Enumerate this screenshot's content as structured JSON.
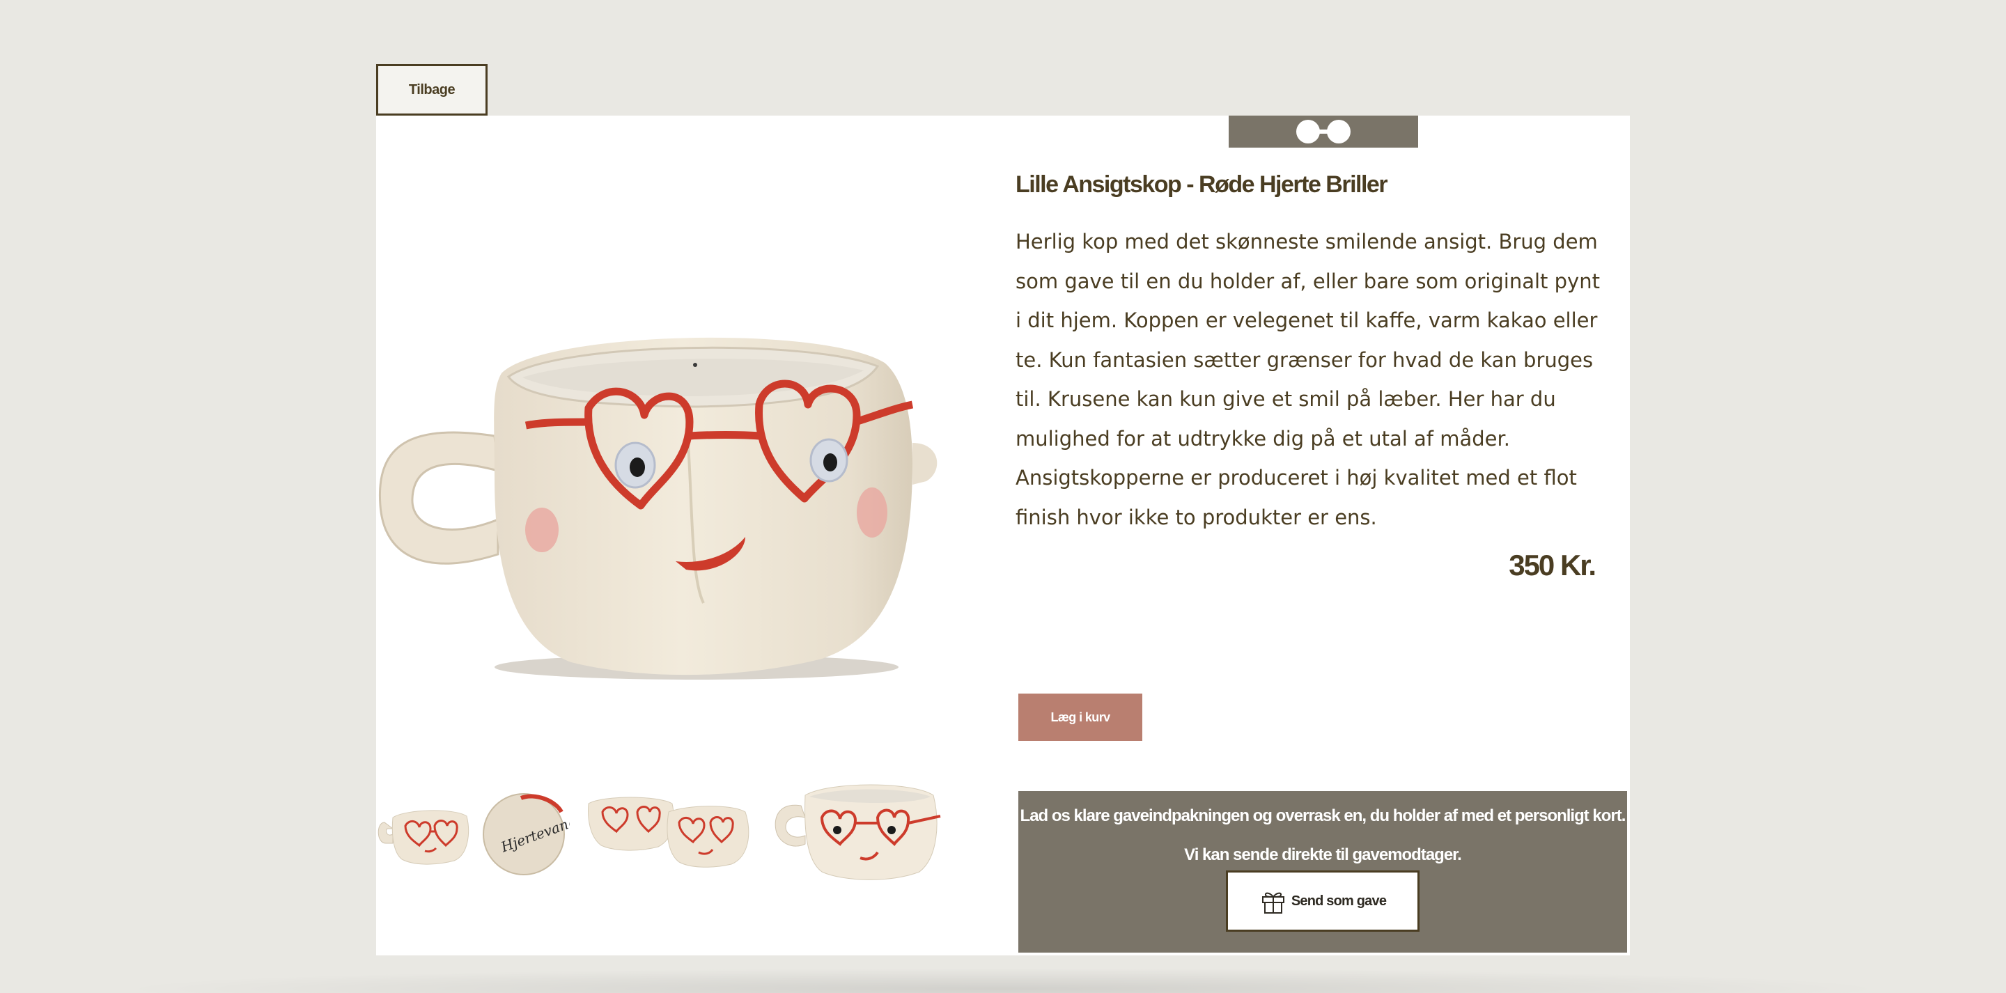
{
  "nav": {
    "back_label": "Tilbage"
  },
  "logo": {
    "icon": "glasses-icon"
  },
  "product": {
    "title": "Lille Ansigtskop - Røde Hjerte Briller",
    "description": "Herlig kop med det skønneste smilende ansigt. Brug dem som gave til en du holder af, eller bare som originalt pynt i dit hjem. Koppen er velegenet til kaffe, varm kakao eller te. Kun fantasien sætter grænser for hvad de kan bruges til. Krusene kan kun give et smil på læber. Her har du mulighed for at udtrykke dig på et utal af måder. Ansigtskopperne er produceret i høj kvalitet med et flot finish hvor ikke to produkter er ens.",
    "price": "350 Kr.",
    "add_to_cart_label": "Læg i kurv",
    "stamp_text": "Hjertevang"
  },
  "gift": {
    "text": "Lad os klare gaveindpakningen og overrask en, du holder af med et personligt kort. Vi kan sende direkte til gavemodtager.",
    "button_label": "Send som gave",
    "button_icon": "gift-icon"
  },
  "colors": {
    "background": "#e9e8e3",
    "text": "#4a3d22",
    "accent_panel": "#7a7468",
    "cart_button": "#b97f70",
    "card": "#ffffff"
  }
}
